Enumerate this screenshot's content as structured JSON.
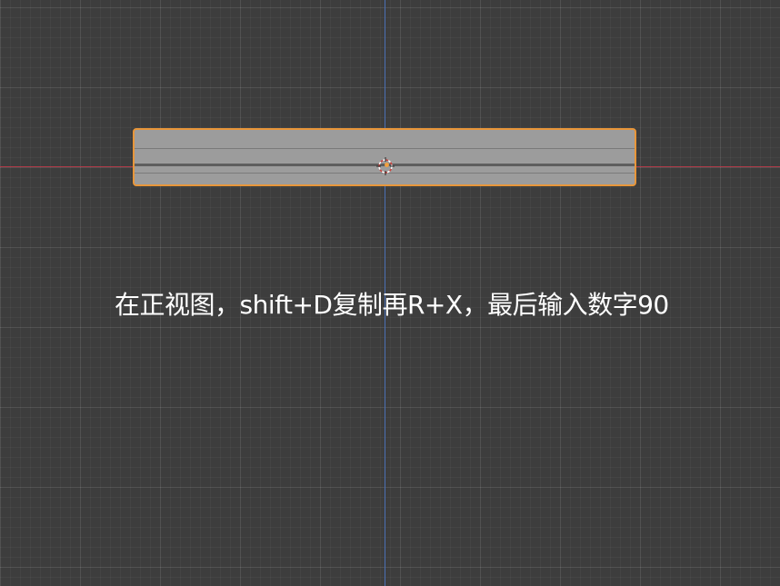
{
  "viewport": {
    "background_color": "#3d3d3d",
    "x_axis_color": "#b03a48",
    "y_axis_color": "#4a6fb5",
    "selection_outline_color": "#e8963a",
    "object_color": "#9c9c9c",
    "cursor_icon": "3d-cursor-icon"
  },
  "caption": {
    "text": "在正视图，shift+D复制再R+X，最后输入数字90"
  }
}
